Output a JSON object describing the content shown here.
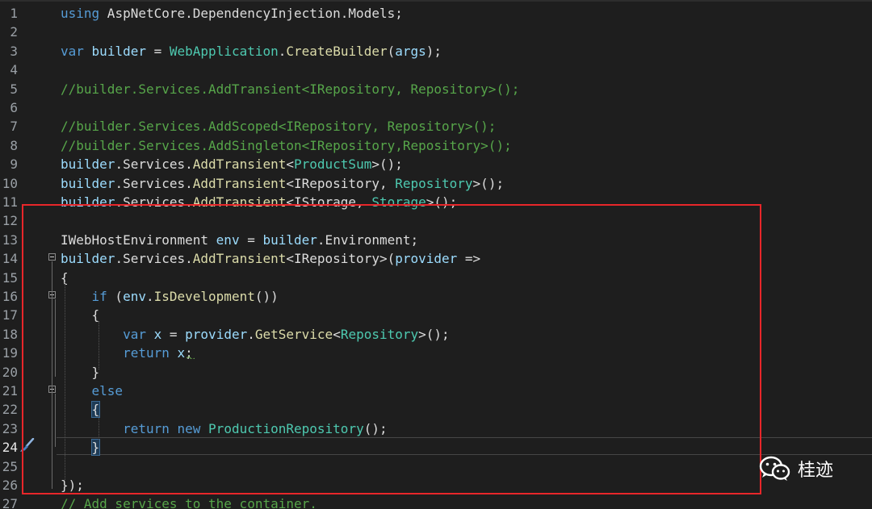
{
  "watermark": {
    "icon": "wechat-icon",
    "text": "桂迹"
  },
  "lines": [
    {
      "n": "1",
      "tokens": [
        {
          "t": "using",
          "c": "kw"
        },
        {
          "t": " AspNetCore.DependencyInjection.Models;",
          "c": "pl"
        }
      ]
    },
    {
      "n": "2",
      "tokens": []
    },
    {
      "n": "3",
      "tokens": [
        {
          "t": "var",
          "c": "kw"
        },
        {
          "t": " ",
          "c": "pl"
        },
        {
          "t": "builder",
          "c": "var"
        },
        {
          "t": " = ",
          "c": "pl"
        },
        {
          "t": "WebApplication",
          "c": "ty"
        },
        {
          "t": ".",
          "c": "pl"
        },
        {
          "t": "CreateBuilder",
          "c": "fn"
        },
        {
          "t": "(",
          "c": "pl"
        },
        {
          "t": "args",
          "c": "var"
        },
        {
          "t": ");",
          "c": "pl"
        }
      ]
    },
    {
      "n": "4",
      "tokens": []
    },
    {
      "n": "5",
      "tokens": [
        {
          "t": "//builder.Services.AddTransient<IRepository, Repository>();",
          "c": "cm"
        }
      ]
    },
    {
      "n": "6",
      "tokens": []
    },
    {
      "n": "7",
      "tokens": [
        {
          "t": "//builder.Services.AddScoped<IRepository, Repository>();",
          "c": "cm"
        }
      ]
    },
    {
      "n": "8",
      "tokens": [
        {
          "t": "//builder.Services.AddSingleton<IRepository,Repository>();",
          "c": "cm"
        }
      ]
    },
    {
      "n": "9",
      "tokens": [
        {
          "t": "builder",
          "c": "var"
        },
        {
          "t": ".Services.",
          "c": "pl"
        },
        {
          "t": "AddTransient",
          "c": "fn"
        },
        {
          "t": "<",
          "c": "pl"
        },
        {
          "t": "ProductSum",
          "c": "ty"
        },
        {
          "t": ">();",
          "c": "pl"
        }
      ]
    },
    {
      "n": "10",
      "tokens": [
        {
          "t": "builder",
          "c": "var"
        },
        {
          "t": ".Services.",
          "c": "pl"
        },
        {
          "t": "AddTransient",
          "c": "fn"
        },
        {
          "t": "<IRepository, ",
          "c": "pl"
        },
        {
          "t": "Repository",
          "c": "ty"
        },
        {
          "t": ">();",
          "c": "pl"
        }
      ]
    },
    {
      "n": "11",
      "tokens": [
        {
          "t": "builder",
          "c": "var"
        },
        {
          "t": ".Services.",
          "c": "pl"
        },
        {
          "t": "AddTransient",
          "c": "fn"
        },
        {
          "t": "<IStorage, ",
          "c": "pl"
        },
        {
          "t": "Storage",
          "c": "ty"
        },
        {
          "t": ">();",
          "c": "pl"
        }
      ]
    },
    {
      "n": "12",
      "tokens": []
    },
    {
      "n": "13",
      "tokens": [
        {
          "t": "IWebHostEnvironment",
          "c": "pl"
        },
        {
          "t": " ",
          "c": "pl"
        },
        {
          "t": "env",
          "c": "var"
        },
        {
          "t": " = ",
          "c": "pl"
        },
        {
          "t": "builder",
          "c": "var"
        },
        {
          "t": ".Environment;",
          "c": "pl"
        }
      ]
    },
    {
      "n": "14",
      "tokens": [
        {
          "t": "builder",
          "c": "var"
        },
        {
          "t": ".Services.",
          "c": "pl"
        },
        {
          "t": "AddTransient",
          "c": "fn"
        },
        {
          "t": "<IRepository>(",
          "c": "pl"
        },
        {
          "t": "provider",
          "c": "var"
        },
        {
          "t": " =>",
          "c": "pl"
        }
      ]
    },
    {
      "n": "15",
      "tokens": [
        {
          "t": "{",
          "c": "pl"
        }
      ]
    },
    {
      "n": "16",
      "tokens": [
        {
          "t": "    ",
          "c": "pl"
        },
        {
          "t": "if",
          "c": "kw"
        },
        {
          "t": " (",
          "c": "pl"
        },
        {
          "t": "env",
          "c": "var"
        },
        {
          "t": ".",
          "c": "pl"
        },
        {
          "t": "IsDevelopment",
          "c": "fn"
        },
        {
          "t": "())",
          "c": "pl"
        }
      ]
    },
    {
      "n": "17",
      "tokens": [
        {
          "t": "    {",
          "c": "pl"
        }
      ]
    },
    {
      "n": "18",
      "tokens": [
        {
          "t": "        ",
          "c": "pl"
        },
        {
          "t": "var",
          "c": "kw"
        },
        {
          "t": " ",
          "c": "pl"
        },
        {
          "t": "x",
          "c": "var"
        },
        {
          "t": " = ",
          "c": "pl"
        },
        {
          "t": "provider",
          "c": "var"
        },
        {
          "t": ".",
          "c": "pl"
        },
        {
          "t": "GetService",
          "c": "fn"
        },
        {
          "t": "<",
          "c": "pl"
        },
        {
          "t": "Repository",
          "c": "ty"
        },
        {
          "t": ">();",
          "c": "pl"
        }
      ]
    },
    {
      "n": "19",
      "tokens": [
        {
          "t": "        ",
          "c": "pl"
        },
        {
          "t": "return",
          "c": "kw"
        },
        {
          "t": " ",
          "c": "pl"
        },
        {
          "t": "x",
          "c": "var"
        },
        {
          "t": ";",
          "c": "pl"
        }
      ]
    },
    {
      "n": "20",
      "tokens": [
        {
          "t": "    }",
          "c": "pl"
        }
      ]
    },
    {
      "n": "21",
      "tokens": [
        {
          "t": "    ",
          "c": "pl"
        },
        {
          "t": "else",
          "c": "kw"
        }
      ]
    },
    {
      "n": "22",
      "tokens": [
        {
          "t": "    ",
          "c": "pl"
        },
        {
          "t": "{",
          "c": "pl brace-hl"
        }
      ]
    },
    {
      "n": "23",
      "tokens": [
        {
          "t": "        ",
          "c": "pl"
        },
        {
          "t": "return",
          "c": "kw"
        },
        {
          "t": " ",
          "c": "pl"
        },
        {
          "t": "new",
          "c": "kw"
        },
        {
          "t": " ",
          "c": "pl"
        },
        {
          "t": "ProductionRepository",
          "c": "ty"
        },
        {
          "t": "();",
          "c": "pl"
        }
      ]
    },
    {
      "n": "24",
      "tokens": [
        {
          "t": "    ",
          "c": "pl"
        },
        {
          "t": "}",
          "c": "pl brace-hl"
        }
      ],
      "active": true
    },
    {
      "n": "25",
      "tokens": []
    },
    {
      "n": "26",
      "tokens": [
        {
          "t": "});",
          "c": "pl"
        }
      ]
    },
    {
      "n": "27",
      "tokens": [
        {
          "t": "// Add services to the container.",
          "c": "cm"
        }
      ]
    }
  ]
}
